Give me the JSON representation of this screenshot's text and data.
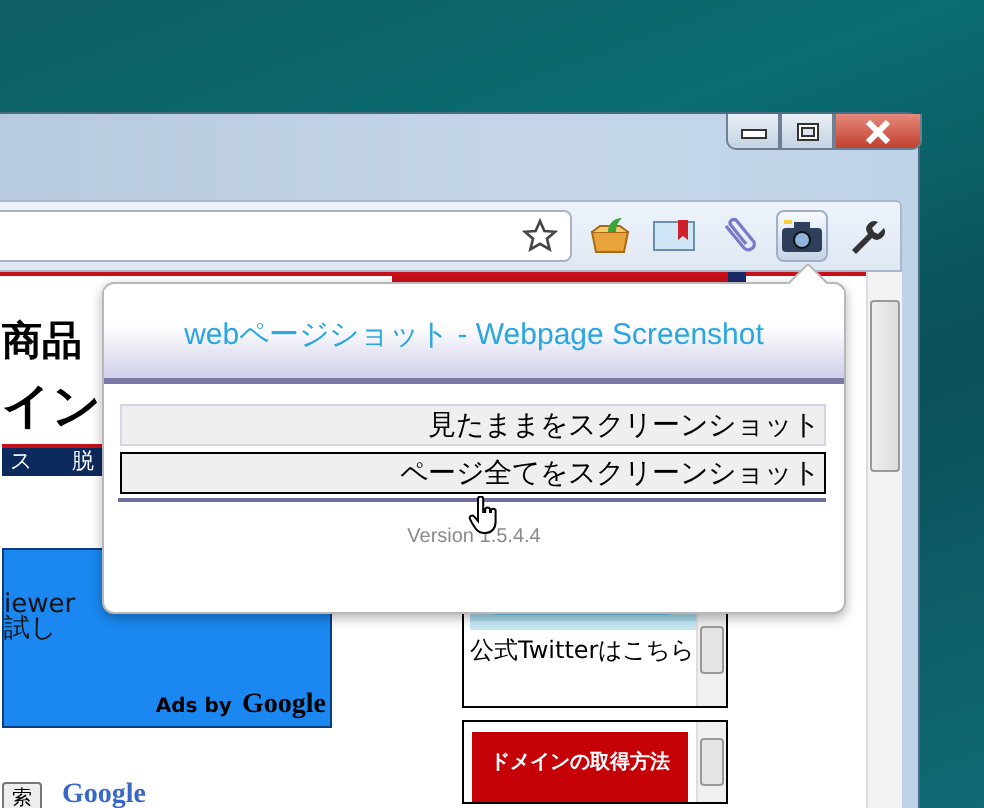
{
  "window": {
    "controls": [
      {
        "kind": "minimize"
      },
      {
        "kind": "maximize"
      },
      {
        "kind": "close"
      }
    ]
  },
  "toolbar": {
    "icons": [
      {
        "kind": "star",
        "pressed": false
      },
      {
        "kind": "box",
        "pressed": false
      },
      {
        "kind": "book",
        "pressed": false
      },
      {
        "kind": "clip",
        "pressed": false
      },
      {
        "kind": "camera",
        "pressed": true
      },
      {
        "kind": "wrench",
        "pressed": false
      }
    ]
  },
  "page": {
    "headline_1": "商品",
    "headline_2": "イン",
    "nav": [
      "ス",
      "脱"
    ],
    "ad": {
      "lines": [
        "iewer",
        "試し"
      ],
      "footer": "Ads by",
      "brand": "Google"
    },
    "search_button": "索",
    "search_logo": "Google",
    "twitter_widget": {
      "caption": "公式Twitterはこちら"
    },
    "domain_widget": {
      "label": "ドメインの取得方法"
    }
  },
  "popup": {
    "title": "webページショット - Webpage Screenshot",
    "buttons": [
      {
        "label": "見たままをスクリーンショット",
        "hovered": false
      },
      {
        "label": "ページ全てをスクリーンショット",
        "hovered": true
      }
    ],
    "version": "Version 1.5.4.4"
  }
}
